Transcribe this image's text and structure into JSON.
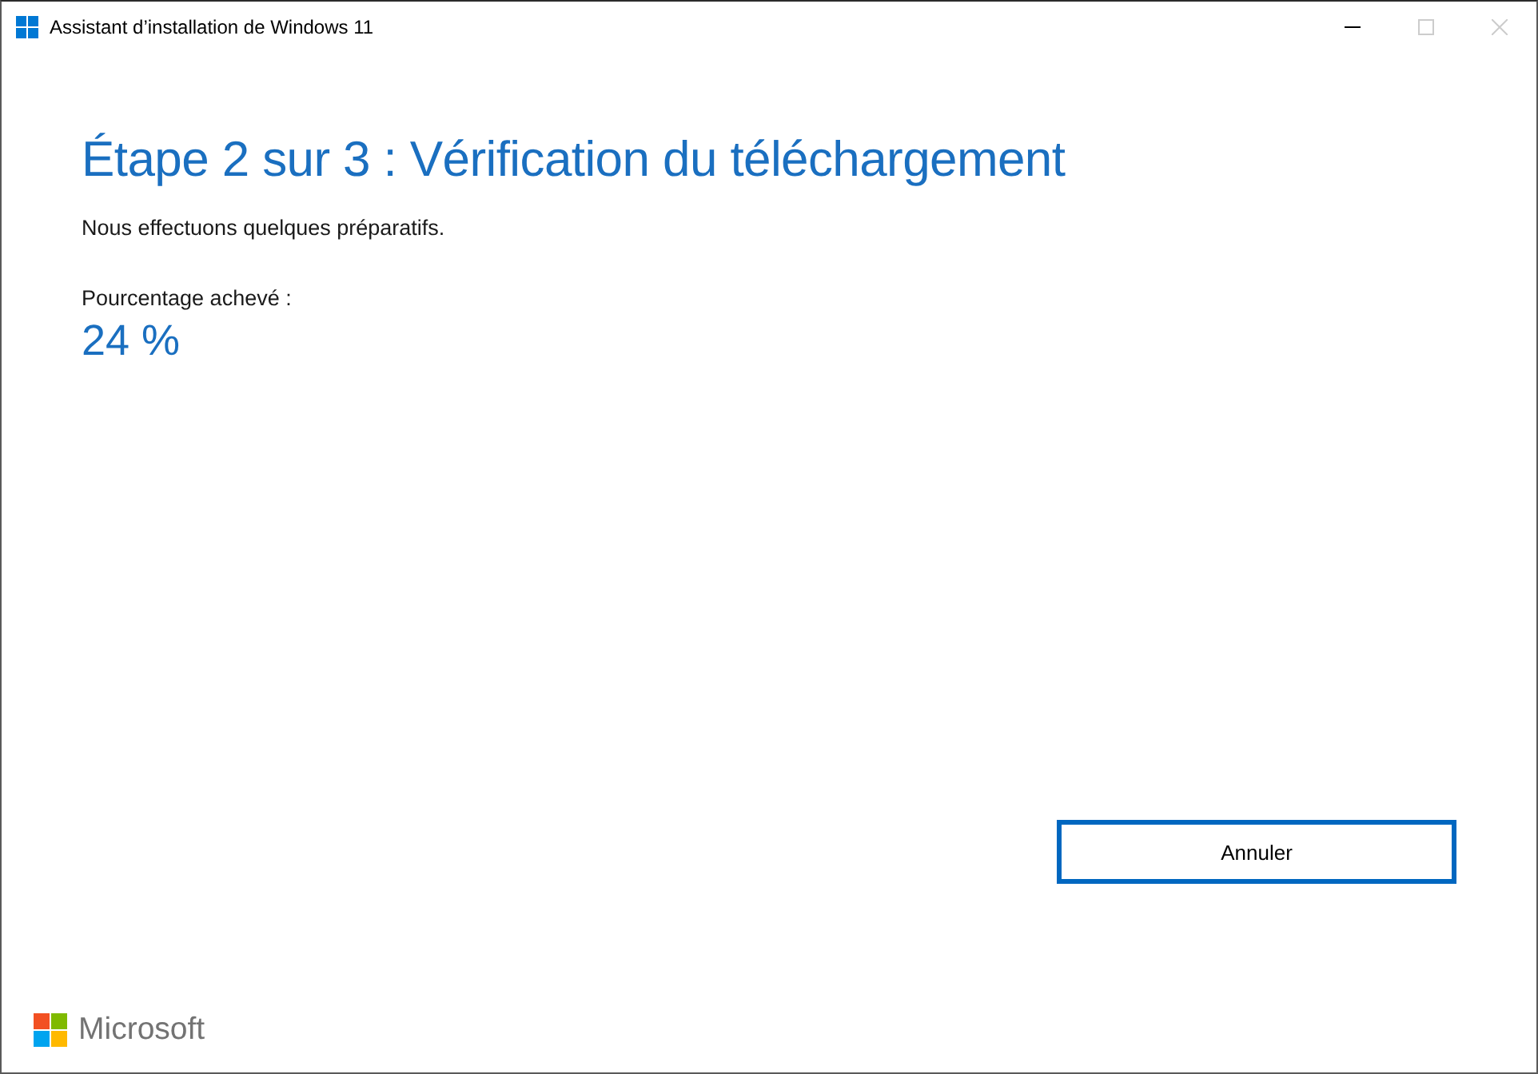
{
  "window": {
    "title": "Assistant d’installation de Windows 11",
    "controls": [
      {
        "kind": "minimize",
        "disabled": false
      },
      {
        "kind": "maximize",
        "disabled": true
      },
      {
        "kind": "close",
        "disabled": true
      }
    ]
  },
  "heading": "Étape 2 sur 3 : Vérification du téléchargement",
  "subtitle": "Nous effectuons quelques préparatifs.",
  "progress_label": "Pourcentage achevé :",
  "progress_value": "24 %",
  "buttons": [
    "Annuler"
  ],
  "footer": {
    "brand": "Microsoft"
  }
}
